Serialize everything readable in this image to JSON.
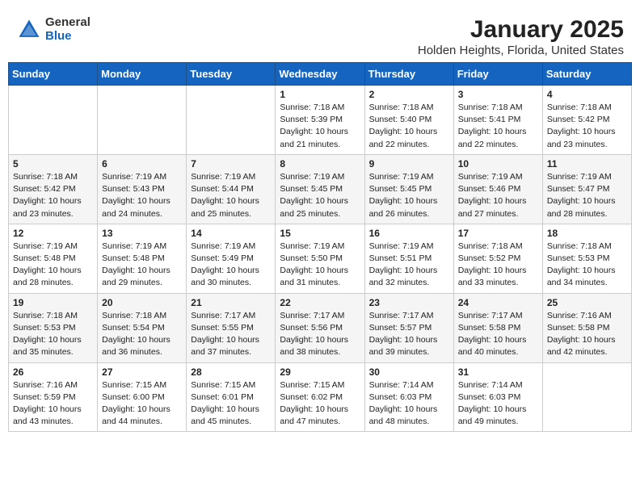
{
  "logo": {
    "general": "General",
    "blue": "Blue"
  },
  "header": {
    "title": "January 2025",
    "location": "Holden Heights, Florida, United States"
  },
  "days_of_week": [
    "Sunday",
    "Monday",
    "Tuesday",
    "Wednesday",
    "Thursday",
    "Friday",
    "Saturday"
  ],
  "weeks": [
    [
      {
        "day": "",
        "info": ""
      },
      {
        "day": "",
        "info": ""
      },
      {
        "day": "",
        "info": ""
      },
      {
        "day": "1",
        "info": "Sunrise: 7:18 AM\nSunset: 5:39 PM\nDaylight: 10 hours\nand 21 minutes."
      },
      {
        "day": "2",
        "info": "Sunrise: 7:18 AM\nSunset: 5:40 PM\nDaylight: 10 hours\nand 22 minutes."
      },
      {
        "day": "3",
        "info": "Sunrise: 7:18 AM\nSunset: 5:41 PM\nDaylight: 10 hours\nand 22 minutes."
      },
      {
        "day": "4",
        "info": "Sunrise: 7:18 AM\nSunset: 5:42 PM\nDaylight: 10 hours\nand 23 minutes."
      }
    ],
    [
      {
        "day": "5",
        "info": "Sunrise: 7:18 AM\nSunset: 5:42 PM\nDaylight: 10 hours\nand 23 minutes."
      },
      {
        "day": "6",
        "info": "Sunrise: 7:19 AM\nSunset: 5:43 PM\nDaylight: 10 hours\nand 24 minutes."
      },
      {
        "day": "7",
        "info": "Sunrise: 7:19 AM\nSunset: 5:44 PM\nDaylight: 10 hours\nand 25 minutes."
      },
      {
        "day": "8",
        "info": "Sunrise: 7:19 AM\nSunset: 5:45 PM\nDaylight: 10 hours\nand 25 minutes."
      },
      {
        "day": "9",
        "info": "Sunrise: 7:19 AM\nSunset: 5:45 PM\nDaylight: 10 hours\nand 26 minutes."
      },
      {
        "day": "10",
        "info": "Sunrise: 7:19 AM\nSunset: 5:46 PM\nDaylight: 10 hours\nand 27 minutes."
      },
      {
        "day": "11",
        "info": "Sunrise: 7:19 AM\nSunset: 5:47 PM\nDaylight: 10 hours\nand 28 minutes."
      }
    ],
    [
      {
        "day": "12",
        "info": "Sunrise: 7:19 AM\nSunset: 5:48 PM\nDaylight: 10 hours\nand 28 minutes."
      },
      {
        "day": "13",
        "info": "Sunrise: 7:19 AM\nSunset: 5:48 PM\nDaylight: 10 hours\nand 29 minutes."
      },
      {
        "day": "14",
        "info": "Sunrise: 7:19 AM\nSunset: 5:49 PM\nDaylight: 10 hours\nand 30 minutes."
      },
      {
        "day": "15",
        "info": "Sunrise: 7:19 AM\nSunset: 5:50 PM\nDaylight: 10 hours\nand 31 minutes."
      },
      {
        "day": "16",
        "info": "Sunrise: 7:19 AM\nSunset: 5:51 PM\nDaylight: 10 hours\nand 32 minutes."
      },
      {
        "day": "17",
        "info": "Sunrise: 7:18 AM\nSunset: 5:52 PM\nDaylight: 10 hours\nand 33 minutes."
      },
      {
        "day": "18",
        "info": "Sunrise: 7:18 AM\nSunset: 5:53 PM\nDaylight: 10 hours\nand 34 minutes."
      }
    ],
    [
      {
        "day": "19",
        "info": "Sunrise: 7:18 AM\nSunset: 5:53 PM\nDaylight: 10 hours\nand 35 minutes."
      },
      {
        "day": "20",
        "info": "Sunrise: 7:18 AM\nSunset: 5:54 PM\nDaylight: 10 hours\nand 36 minutes."
      },
      {
        "day": "21",
        "info": "Sunrise: 7:17 AM\nSunset: 5:55 PM\nDaylight: 10 hours\nand 37 minutes."
      },
      {
        "day": "22",
        "info": "Sunrise: 7:17 AM\nSunset: 5:56 PM\nDaylight: 10 hours\nand 38 minutes."
      },
      {
        "day": "23",
        "info": "Sunrise: 7:17 AM\nSunset: 5:57 PM\nDaylight: 10 hours\nand 39 minutes."
      },
      {
        "day": "24",
        "info": "Sunrise: 7:17 AM\nSunset: 5:58 PM\nDaylight: 10 hours\nand 40 minutes."
      },
      {
        "day": "25",
        "info": "Sunrise: 7:16 AM\nSunset: 5:58 PM\nDaylight: 10 hours\nand 42 minutes."
      }
    ],
    [
      {
        "day": "26",
        "info": "Sunrise: 7:16 AM\nSunset: 5:59 PM\nDaylight: 10 hours\nand 43 minutes."
      },
      {
        "day": "27",
        "info": "Sunrise: 7:15 AM\nSunset: 6:00 PM\nDaylight: 10 hours\nand 44 minutes."
      },
      {
        "day": "28",
        "info": "Sunrise: 7:15 AM\nSunset: 6:01 PM\nDaylight: 10 hours\nand 45 minutes."
      },
      {
        "day": "29",
        "info": "Sunrise: 7:15 AM\nSunset: 6:02 PM\nDaylight: 10 hours\nand 47 minutes."
      },
      {
        "day": "30",
        "info": "Sunrise: 7:14 AM\nSunset: 6:03 PM\nDaylight: 10 hours\nand 48 minutes."
      },
      {
        "day": "31",
        "info": "Sunrise: 7:14 AM\nSunset: 6:03 PM\nDaylight: 10 hours\nand 49 minutes."
      },
      {
        "day": "",
        "info": ""
      }
    ]
  ]
}
